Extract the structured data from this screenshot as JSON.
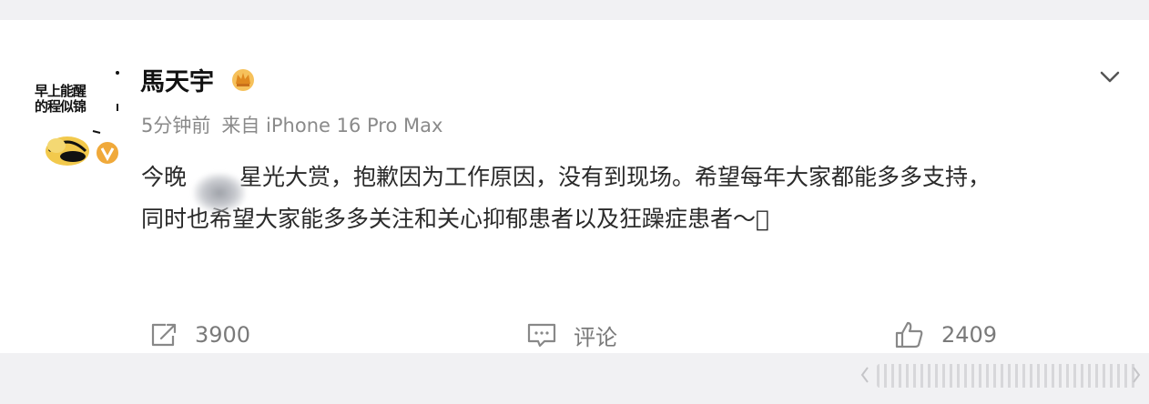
{
  "post": {
    "avatar_text_line1": "早上能醒",
    "avatar_text_line2": "的程似锦",
    "username": "馬天宇",
    "time": "5分钟前",
    "source": "来自 iPhone 16 Pro Max",
    "body_line1": "今晚",
    "body_line1_rest": "星光大赏，抱歉因为工作原因，没有到现场。希望每年大家都能多多支持，",
    "body_line2": "同时也希望大家能多多关注和关心抑郁患者以及狂躁症患者～􏿿"
  },
  "actions": {
    "repost_count": "3900",
    "comment_label": "评论",
    "like_count": "2409"
  },
  "icons": {
    "badge": "crown-badge-icon",
    "verified": "verified-v-icon",
    "menu": "chevron-down-icon",
    "repost": "repost-icon",
    "comment": "comment-icon",
    "like": "thumbs-up-icon"
  },
  "colors": {
    "accent_badge": "#e8a23a",
    "verified": "#e8a23a",
    "meta_text": "#8a8a8a",
    "action_text": "#7a7a7a"
  }
}
